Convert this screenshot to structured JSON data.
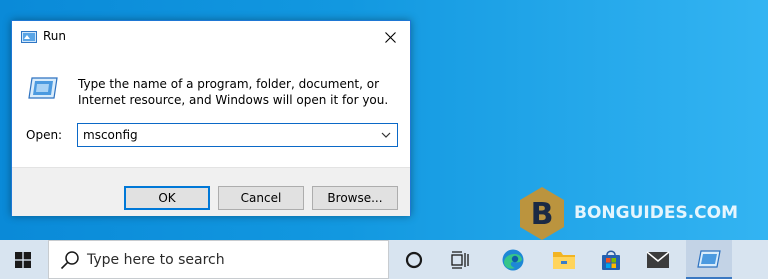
{
  "dialog": {
    "title": "Run",
    "description": "Type the name of a program, folder, document, or Internet resource, and Windows will open it for you.",
    "open_label": "Open:",
    "open_value": "msconfig",
    "buttons": {
      "ok": "OK",
      "cancel": "Cancel",
      "browse": "Browse..."
    }
  },
  "watermark": {
    "text": "BONGUIDES.COM",
    "logo_letter": "B"
  },
  "taskbar": {
    "search_placeholder": "Type here to search",
    "icons": [
      "windows-start-icon",
      "cortana-icon",
      "task-view-icon",
      "edge-icon",
      "file-explorer-icon",
      "store-icon",
      "mail-icon",
      "run-icon"
    ]
  },
  "colors": {
    "desktop": "#1298e0",
    "dialog_border": "#1e77d4",
    "accent": "#0078d7",
    "watermark_logo": "#c9932f",
    "taskbar": "#d8e4f0"
  }
}
